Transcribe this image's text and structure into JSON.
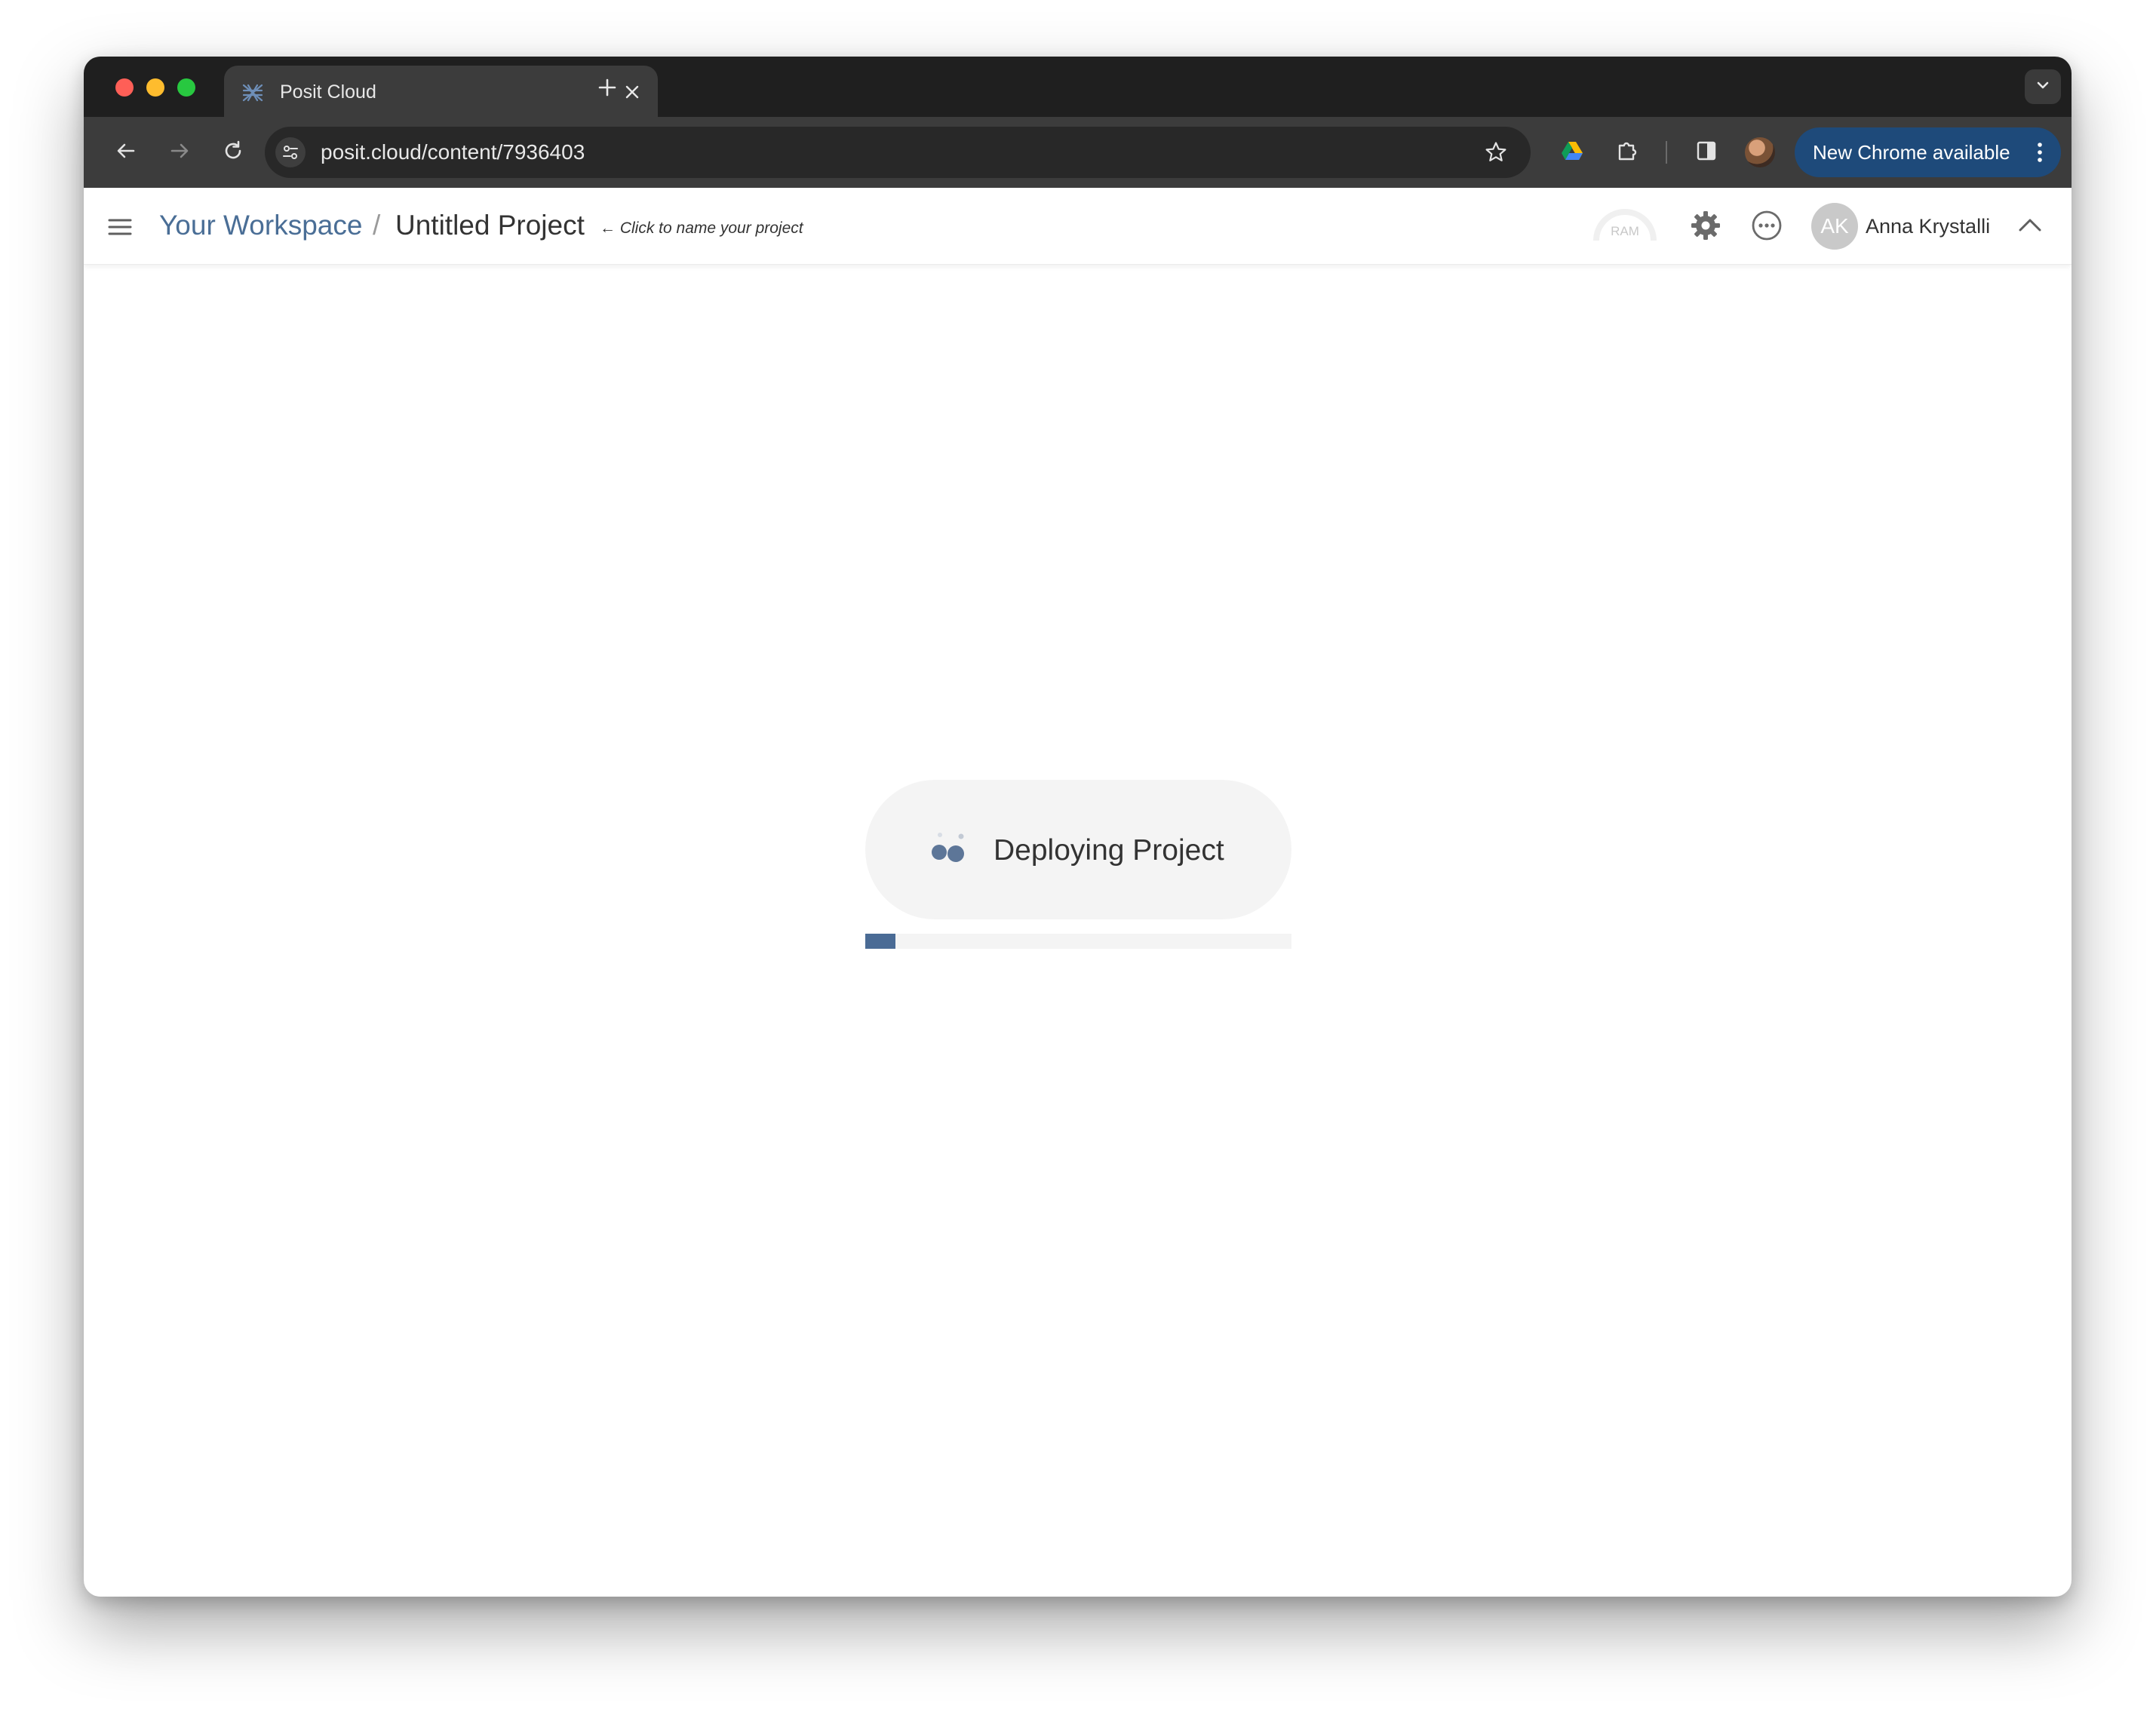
{
  "browser": {
    "tab": {
      "title": "Posit Cloud",
      "favicon": "posit-logo-icon",
      "close_icon": "close-icon"
    },
    "new_tab_icon": "plus-icon",
    "tab_search_icon": "chevron-down-icon",
    "toolbar": {
      "back_icon": "arrow-left-icon",
      "forward_icon": "arrow-right-icon",
      "reload_icon": "reload-icon",
      "site_info_icon": "tune-icon",
      "url": "posit.cloud/content/7936403",
      "bookmark_icon": "star-icon",
      "extensions": [
        "google-drive-icon",
        "puzzle-icon"
      ],
      "side_panel_icon": "side-panel-icon",
      "profile_icon": "profile-avatar-icon",
      "update_button_label": "New Chrome available",
      "update_menu_icon": "kebab-menu-icon"
    }
  },
  "app": {
    "header": {
      "menu_icon": "hamburger-icon",
      "breadcrumb": {
        "workspace": "Your Workspace",
        "separator": "/"
      },
      "project_title": "Untitled Project",
      "name_hint": "← Click to name your project",
      "ram_label": "RAM",
      "settings_icon": "gear-icon",
      "more_icon": "more-horizontal-icon",
      "user": {
        "initials": "AK",
        "name": "Anna Krystalli"
      },
      "collapse_icon": "chevron-up-icon"
    },
    "status": {
      "label": "Deploying Project",
      "spinner_icon": "loading-dots-icon",
      "progress_percent": 7
    }
  },
  "colors": {
    "accent": "#4a6b95",
    "link": "#4a6e96",
    "update_button": "#1e4a7a",
    "pill_background": "#f4f4f4"
  }
}
